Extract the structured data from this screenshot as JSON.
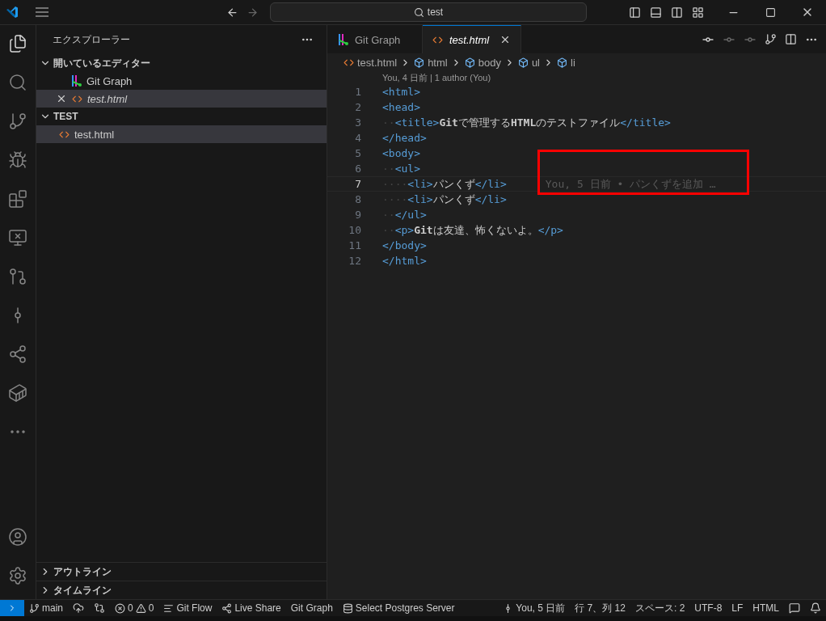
{
  "title_bar": {
    "search": "test"
  },
  "activity_bar": {
    "items": [
      {
        "selected": true
      },
      {
        "selected": false
      },
      {
        "selected": false
      },
      {
        "selected": false
      },
      {
        "selected": false
      },
      {
        "selected": false
      },
      {
        "selected": false
      },
      {
        "selected": false
      },
      {
        "selected": false
      },
      {
        "selected": false
      },
      {
        "selected": false
      }
    ]
  },
  "sidebar": {
    "title": "エクスプローラー",
    "sections": [
      {
        "label": "開いているエディター",
        "expanded": true,
        "items": [
          {
            "label": "Git Graph",
            "kind": "git-graph",
            "italic": false,
            "selected": false,
            "closable": false
          },
          {
            "label": "test.html",
            "kind": "html",
            "italic": true,
            "selected": true,
            "closable": true
          }
        ]
      },
      {
        "label": "TEST",
        "expanded": true,
        "items": [
          {
            "label": "test.html",
            "kind": "html",
            "italic": false,
            "selected": true,
            "closable": false
          }
        ]
      }
    ],
    "bottom_sections": [
      {
        "label": "アウトライン",
        "expanded": false
      },
      {
        "label": "タイムライン",
        "expanded": false
      }
    ]
  },
  "tabs": [
    {
      "label": "Git Graph",
      "kind": "git-graph",
      "selected": false,
      "italic": false
    },
    {
      "label": "test.html",
      "kind": "html",
      "selected": true,
      "italic": true
    }
  ],
  "breadcrumbs": [
    {
      "label": "test.html",
      "kind": "html"
    },
    {
      "label": "html",
      "kind": "symbol"
    },
    {
      "label": "body",
      "kind": "symbol"
    },
    {
      "label": "ul",
      "kind": "symbol"
    },
    {
      "label": "li",
      "kind": "symbol"
    }
  ],
  "codelens": "You, 4 日前 | 1 author (You)",
  "code_lines": [
    {
      "number": "1",
      "current": false,
      "tokens": [
        {
          "kind": "tag",
          "text": "<html>"
        }
      ]
    },
    {
      "number": "2",
      "current": false,
      "tokens": [
        {
          "kind": "tag",
          "text": "<head>"
        }
      ]
    },
    {
      "number": "3",
      "current": false,
      "tokens": [
        {
          "kind": "ws",
          "text": "··"
        },
        {
          "kind": "tag",
          "text": "<title>"
        },
        {
          "kind": "text",
          "text": "**Git**で管理する**HTML**のテストファイル"
        },
        {
          "kind": "tag",
          "text": "</title>"
        }
      ]
    },
    {
      "number": "4",
      "current": false,
      "tokens": [
        {
          "kind": "tag",
          "text": "</head>"
        }
      ]
    },
    {
      "number": "5",
      "current": false,
      "tokens": [
        {
          "kind": "tag",
          "text": "<body>"
        }
      ]
    },
    {
      "number": "6",
      "current": false,
      "tokens": [
        {
          "kind": "ws",
          "text": "··"
        },
        {
          "kind": "tag",
          "text": "<ul>"
        }
      ]
    },
    {
      "number": "7",
      "current": true,
      "tokens": [
        {
          "kind": "ws",
          "text": "····"
        },
        {
          "kind": "tag",
          "text": "<li>"
        },
        {
          "kind": "text",
          "text": "パンくず"
        },
        {
          "kind": "tag",
          "text": "</li>"
        }
      ],
      "blame": "You, 5 日前 • パンくずを追加 …"
    },
    {
      "number": "8",
      "current": false,
      "tokens": [
        {
          "kind": "ws",
          "text": "····"
        },
        {
          "kind": "tag",
          "text": "<li>"
        },
        {
          "kind": "text",
          "text": "パンくず"
        },
        {
          "kind": "tag",
          "text": "</li>"
        }
      ]
    },
    {
      "number": "9",
      "current": false,
      "tokens": [
        {
          "kind": "ws",
          "text": "··"
        },
        {
          "kind": "tag",
          "text": "</ul>"
        }
      ]
    },
    {
      "number": "10",
      "current": false,
      "tokens": [
        {
          "kind": "ws",
          "text": "··"
        },
        {
          "kind": "tag",
          "text": "<p>"
        },
        {
          "kind": "text",
          "text": "**Git**は友達、怖くないよ。"
        },
        {
          "kind": "tag",
          "text": "</p>"
        }
      ]
    },
    {
      "number": "11",
      "current": false,
      "tokens": [
        {
          "kind": "tag",
          "text": "</body>"
        }
      ]
    },
    {
      "number": "12",
      "current": false,
      "tokens": [
        {
          "kind": "tag",
          "text": "</html>"
        }
      ]
    }
  ],
  "status_bar": {
    "left": [
      {
        "kind": "branch",
        "text": "main"
      },
      {
        "kind": "sync"
      },
      {
        "kind": "gitlens"
      },
      {
        "kind": "problems",
        "errors": "0",
        "warnings": "0"
      },
      {
        "kind": "list",
        "text": "Git Flow"
      },
      {
        "kind": "liveshare",
        "text": "Live Share"
      },
      {
        "kind": "plain",
        "text": "Git Graph"
      },
      {
        "kind": "db",
        "text": "Select Postgres Server"
      }
    ],
    "right": [
      {
        "kind": "commit",
        "text": "You, 5 日前"
      },
      {
        "kind": "plain",
        "text": "行 7、列 12"
      },
      {
        "kind": "plain",
        "text": "スペース: 2"
      },
      {
        "kind": "plain",
        "text": "UTF-8"
      },
      {
        "kind": "plain",
        "text": "LF"
      },
      {
        "kind": "plain",
        "text": "HTML"
      },
      {
        "kind": "feedback"
      },
      {
        "kind": "bell"
      }
    ]
  }
}
